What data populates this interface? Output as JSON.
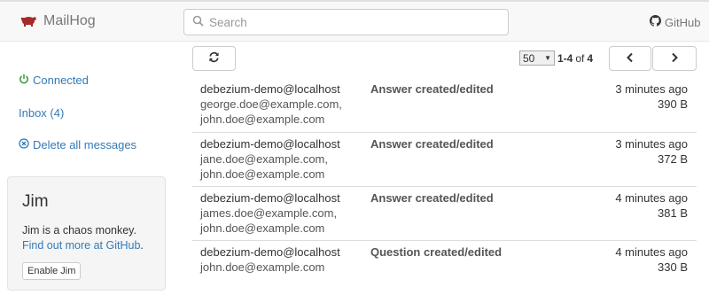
{
  "navbar": {
    "brand": "MailHog",
    "search_placeholder": "Search",
    "github_label": "GitHub"
  },
  "sidebar": {
    "connected_label": "Connected",
    "inbox_label": "Inbox (4)",
    "delete_label": "Delete all messages"
  },
  "jim": {
    "title": "Jim",
    "description": "Jim is a chaos monkey.",
    "link_label": "Find out more at GitHub",
    "link_suffix": ".",
    "button_label": "Enable Jim"
  },
  "toolbar": {
    "page_size": "50",
    "range": "1-4",
    "of_label": "of",
    "total": "4"
  },
  "messages": [
    {
      "from": "debezium-demo@localhost",
      "to": [
        "george.doe@example.com,",
        "john.doe@example.com"
      ],
      "subject": "Answer created/edited",
      "time": "3 minutes ago",
      "size": "390 B"
    },
    {
      "from": "debezium-demo@localhost",
      "to": [
        "jane.doe@example.com,",
        "john.doe@example.com"
      ],
      "subject": "Answer created/edited",
      "time": "3 minutes ago",
      "size": "372 B"
    },
    {
      "from": "debezium-demo@localhost",
      "to": [
        "james.doe@example.com,",
        "john.doe@example.com"
      ],
      "subject": "Answer created/edited",
      "time": "4 minutes ago",
      "size": "381 B"
    },
    {
      "from": "debezium-demo@localhost",
      "to": [
        "john.doe@example.com"
      ],
      "subject": "Question created/edited",
      "time": "4 minutes ago",
      "size": "330 B"
    }
  ],
  "colors": {
    "link": "#337ab7",
    "connected": "#3c9a3c",
    "brand_logo": "#a52a2a"
  }
}
